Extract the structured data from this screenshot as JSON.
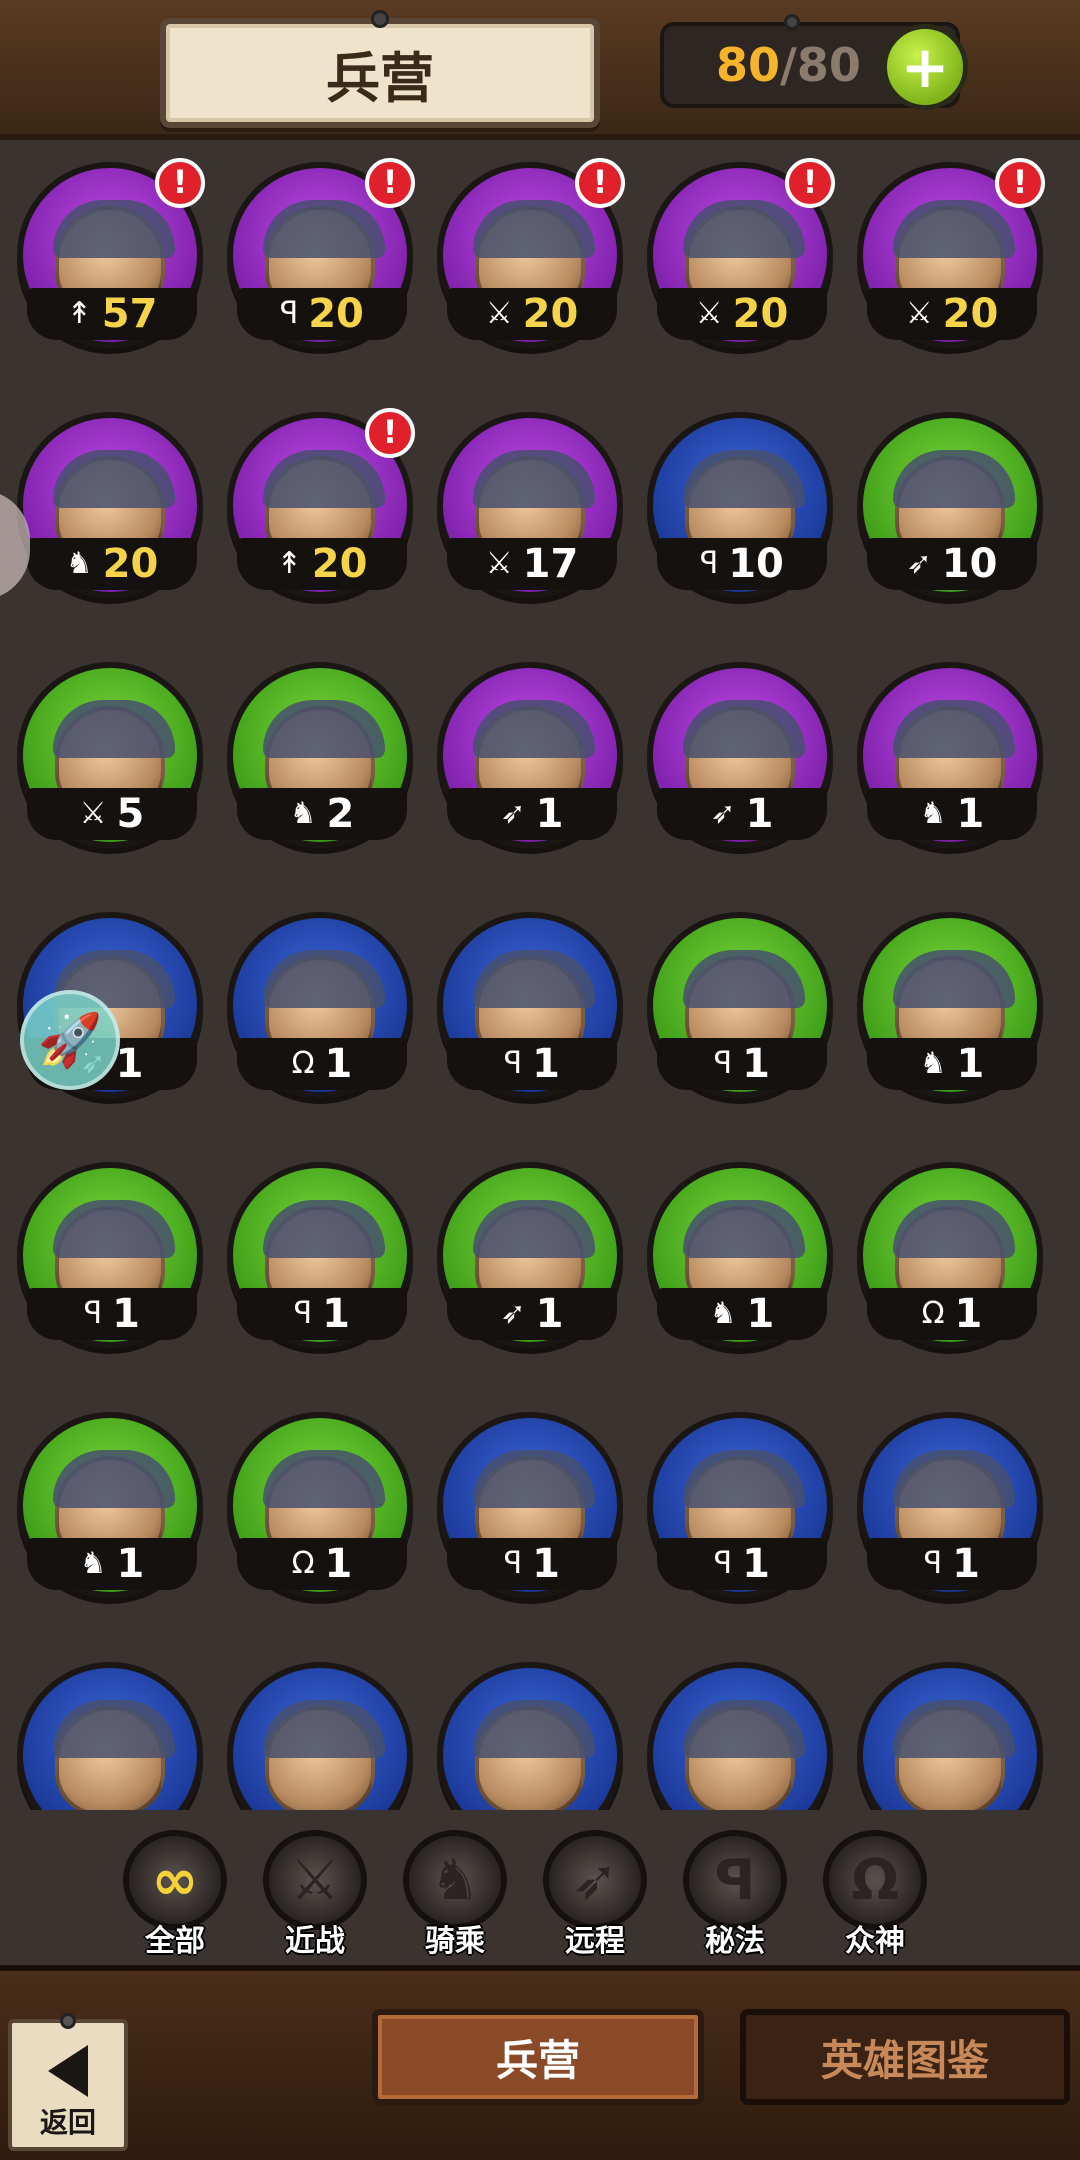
{
  "header": {
    "title": "兵营"
  },
  "currency": {
    "current": "80",
    "sep": "/",
    "max": "80",
    "plus_label": "+"
  },
  "units": [
    {
      "color": "purple",
      "type": "spear",
      "level": "57",
      "alert": true
    },
    {
      "color": "purple",
      "type": "magic",
      "level": "20",
      "alert": true
    },
    {
      "color": "purple",
      "type": "sword",
      "level": "20",
      "alert": true
    },
    {
      "color": "purple",
      "type": "sword",
      "level": "20",
      "alert": true
    },
    {
      "color": "purple",
      "type": "sword",
      "level": "20",
      "alert": true
    },
    {
      "color": "purple",
      "type": "mount",
      "level": "20",
      "alert": false
    },
    {
      "color": "purple",
      "type": "spear",
      "level": "20",
      "alert": true
    },
    {
      "color": "purple",
      "type": "sword",
      "level": "17",
      "alert": false
    },
    {
      "color": "blue",
      "type": "magic",
      "level": "10",
      "alert": false
    },
    {
      "color": "green",
      "type": "bow",
      "level": "10",
      "alert": false
    },
    {
      "color": "green",
      "type": "sword",
      "level": "5",
      "alert": false
    },
    {
      "color": "green",
      "type": "mount",
      "level": "2",
      "alert": false
    },
    {
      "color": "purple",
      "type": "bow",
      "level": "1",
      "alert": false
    },
    {
      "color": "purple",
      "type": "bow",
      "level": "1",
      "alert": false
    },
    {
      "color": "purple",
      "type": "mount",
      "level": "1",
      "alert": false
    },
    {
      "color": "blue",
      "type": "bow",
      "level": "1",
      "alert": false
    },
    {
      "color": "blue",
      "type": "omega",
      "level": "1",
      "alert": false
    },
    {
      "color": "blue",
      "type": "magic",
      "level": "1",
      "alert": false
    },
    {
      "color": "green",
      "type": "magic",
      "level": "1",
      "alert": false
    },
    {
      "color": "green",
      "type": "mount",
      "level": "1",
      "alert": false
    },
    {
      "color": "green",
      "type": "magic",
      "level": "1",
      "alert": false
    },
    {
      "color": "green",
      "type": "magic",
      "level": "1",
      "alert": false
    },
    {
      "color": "green",
      "type": "bow",
      "level": "1",
      "alert": false
    },
    {
      "color": "green",
      "type": "mount",
      "level": "1",
      "alert": false
    },
    {
      "color": "green",
      "type": "omega",
      "level": "1",
      "alert": false
    },
    {
      "color": "green",
      "type": "mount",
      "level": "1",
      "alert": false
    },
    {
      "color": "green",
      "type": "omega",
      "level": "1",
      "alert": false
    },
    {
      "color": "blue",
      "type": "magic",
      "level": "1",
      "alert": false
    },
    {
      "color": "blue",
      "type": "magic",
      "level": "1",
      "alert": false
    },
    {
      "color": "blue",
      "type": "magic",
      "level": "1",
      "alert": false
    },
    {
      "color": "blue",
      "type": "none",
      "level": "",
      "alert": false
    },
    {
      "color": "blue",
      "type": "none",
      "level": "",
      "alert": false
    },
    {
      "color": "blue",
      "type": "none",
      "level": "",
      "alert": false
    },
    {
      "color": "blue",
      "type": "none",
      "level": "",
      "alert": false
    },
    {
      "color": "blue",
      "type": "none",
      "level": "",
      "alert": false
    }
  ],
  "filters": [
    {
      "label": "全部",
      "icon": "∞",
      "active": true
    },
    {
      "label": "近战",
      "icon": "⚔",
      "active": false
    },
    {
      "label": "骑乘",
      "icon": "♞",
      "active": false
    },
    {
      "label": "远程",
      "icon": "➶",
      "active": false
    },
    {
      "label": "秘法",
      "icon": "ꟼ",
      "active": false
    },
    {
      "label": "众神",
      "icon": "Ω",
      "active": false
    }
  ],
  "tabs": {
    "barracks": "兵营",
    "codex": "英雄图鉴"
  },
  "back": {
    "label": "返回"
  }
}
